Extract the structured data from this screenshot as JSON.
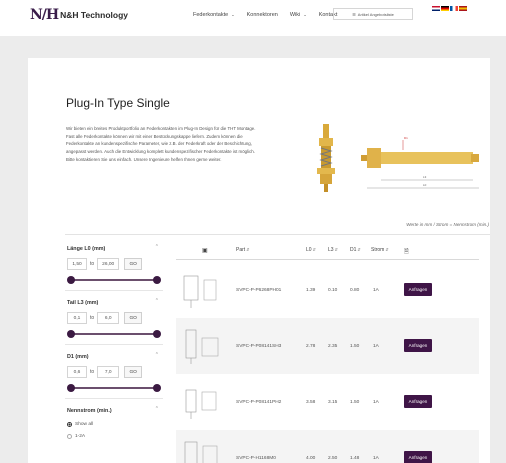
{
  "header": {
    "logo_mark": "N/H",
    "logo_text": "N&H Technology",
    "nav": [
      {
        "label": "Federkontakte",
        "has_dropdown": true
      },
      {
        "label": "Konnektoren",
        "has_dropdown": false
      },
      {
        "label": "Wiki",
        "has_dropdown": true
      },
      {
        "label": "Kontakt",
        "has_dropdown": false
      }
    ],
    "request_button": "Artikel Angebotsliste",
    "languages": [
      "EN",
      "DE",
      "FR",
      "ES"
    ]
  },
  "page": {
    "title": "Plug-In Type Single",
    "intro": "Wir bieten ein breites Produktportfolio an Federkontakten im Plug-In Design für die THT Montage. Fast alle Federkontakte können wir mit einer Bestückungskappe liefern. Zudem können die Federkontakte an kundenspezifische Parameter, wie z.B. der Federkraft oder der Beschichtung, angepasst werden. Auch die Entwicklung komplett kundenspezifischer Federkontakte ist möglich. Bitte kontaktieren Sie uns einfach. Unsere Ingenieure helfen Ihnen gerne weiter.",
    "units_note": "Werte in mm / Strom = Nennstrom (min.)",
    "diagram_labels": {
      "d1": "D1",
      "l3": "L3",
      "l0": "L0"
    }
  },
  "filters": {
    "length": {
      "label": "Länge L0 (mm)",
      "min": "1,50",
      "to": "to",
      "max": "26,00",
      "go": "GO"
    },
    "tail": {
      "label": "Tail L3 (mm)",
      "min": "0,1",
      "to": "to",
      "max": "6,0",
      "go": "GO"
    },
    "d1": {
      "label": "D1 (mm)",
      "min": "0,6",
      "to": "to",
      "max": "7,0",
      "go": "GO"
    },
    "current": {
      "label": "Nennstrom (min.)",
      "options": [
        "Show all",
        "1-2A"
      ],
      "selected": "Show all"
    }
  },
  "table": {
    "headers": {
      "part": "Part",
      "l0": "L0",
      "l3": "L3",
      "d1": "D1",
      "strom": "Strom"
    },
    "buy_label": "Anfragen",
    "rows": [
      {
        "part": "SVPC-P-P6268PH01",
        "l0": "1.39",
        "l3": "0.10",
        "d1": "0.80",
        "strom": "1A"
      },
      {
        "part": "SVPC-P-P08141SH3",
        "l0": "2.78",
        "l3": "2.35",
        "d1": "1.50",
        "strom": "1A"
      },
      {
        "part": "SVPC-P-P08141PH2",
        "l0": "3.58",
        "l3": "3.15",
        "d1": "1.50",
        "strom": "1A"
      },
      {
        "part": "SVPC-P-H1168M0",
        "l0": "4.00",
        "l3": "2.50",
        "d1": "1.48",
        "strom": "1A"
      }
    ]
  },
  "colors": {
    "brand": "#3f1547",
    "slider": "#3b1a42",
    "background": "#ececec"
  }
}
